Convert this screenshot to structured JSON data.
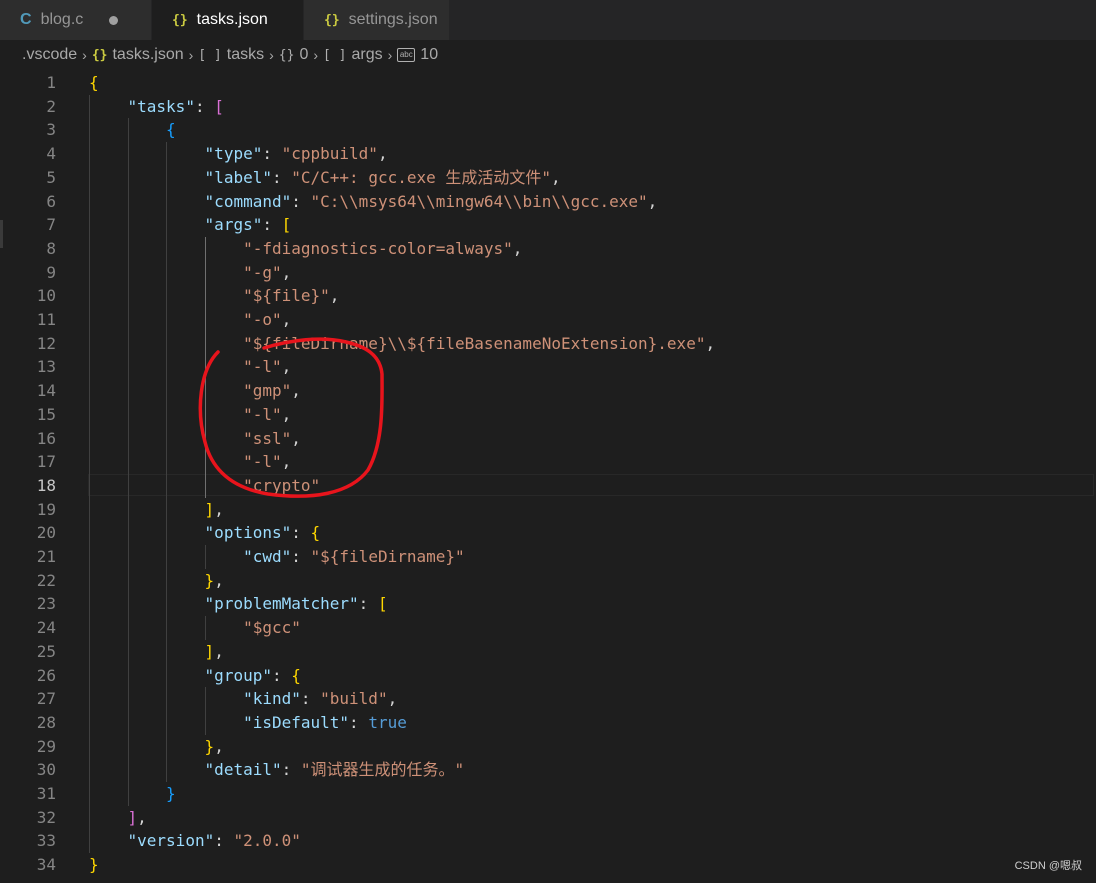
{
  "tabs": [
    {
      "label": "blog.c",
      "icon": "c-file-icon",
      "glyph": "C",
      "active": false,
      "dirty": true
    },
    {
      "label": "tasks.json",
      "icon": "json-file-icon",
      "glyph": "{}",
      "active": true,
      "dirty": true
    },
    {
      "label": "settings.json",
      "icon": "json-file-icon",
      "glyph": "{}",
      "active": false,
      "dirty": false
    }
  ],
  "breadcrumb": [
    {
      "label": ".vscode",
      "icon": ""
    },
    {
      "label": "tasks.json",
      "icon": "json-file-icon"
    },
    {
      "label": "tasks",
      "icon": "array-icon"
    },
    {
      "label": "0",
      "icon": "object-icon"
    },
    {
      "label": "args",
      "icon": "array-icon"
    },
    {
      "label": "10",
      "icon": "string-icon"
    }
  ],
  "current_line": 18,
  "lines": [
    {
      "n": "1",
      "indent": 0,
      "tokens": [
        [
          "{",
          "b1"
        ]
      ]
    },
    {
      "n": "2",
      "indent": 1,
      "tokens": [
        [
          "\"tasks\"",
          "k"
        ],
        [
          ": ",
          "p"
        ],
        [
          "[",
          "b2"
        ]
      ]
    },
    {
      "n": "3",
      "indent": 2,
      "tokens": [
        [
          "{",
          "b3"
        ]
      ]
    },
    {
      "n": "4",
      "indent": 3,
      "tokens": [
        [
          "\"type\"",
          "k"
        ],
        [
          ": ",
          "p"
        ],
        [
          "\"cppbuild\"",
          "s"
        ],
        [
          ",",
          "p"
        ]
      ]
    },
    {
      "n": "5",
      "indent": 3,
      "tokens": [
        [
          "\"label\"",
          "k"
        ],
        [
          ": ",
          "p"
        ],
        [
          "\"C/C++: gcc.exe 生成活动文件\"",
          "s"
        ],
        [
          ",",
          "p"
        ]
      ]
    },
    {
      "n": "6",
      "indent": 3,
      "tokens": [
        [
          "\"command\"",
          "k"
        ],
        [
          ": ",
          "p"
        ],
        [
          "\"C:\\\\msys64\\\\mingw64\\\\bin\\\\gcc.exe\"",
          "s"
        ],
        [
          ",",
          "p"
        ]
      ]
    },
    {
      "n": "7",
      "indent": 3,
      "tokens": [
        [
          "\"args\"",
          "k"
        ],
        [
          ": ",
          "p"
        ],
        [
          "[",
          "b1"
        ]
      ]
    },
    {
      "n": "8",
      "indent": 4,
      "tokens": [
        [
          "\"-fdiagnostics-color=always\"",
          "s"
        ],
        [
          ",",
          "p"
        ]
      ]
    },
    {
      "n": "9",
      "indent": 4,
      "tokens": [
        [
          "\"-g\"",
          "s"
        ],
        [
          ",",
          "p"
        ]
      ]
    },
    {
      "n": "10",
      "indent": 4,
      "tokens": [
        [
          "\"${file}\"",
          "s"
        ],
        [
          ",",
          "p"
        ]
      ]
    },
    {
      "n": "11",
      "indent": 4,
      "tokens": [
        [
          "\"-o\"",
          "s"
        ],
        [
          ",",
          "p"
        ]
      ]
    },
    {
      "n": "12",
      "indent": 4,
      "tokens": [
        [
          "\"${fileDirname}\\\\${fileBasenameNoExtension}.exe\"",
          "s"
        ],
        [
          ",",
          "p"
        ]
      ]
    },
    {
      "n": "13",
      "indent": 4,
      "tokens": [
        [
          "\"-l\"",
          "s"
        ],
        [
          ",",
          "p"
        ]
      ]
    },
    {
      "n": "14",
      "indent": 4,
      "tokens": [
        [
          "\"gmp\"",
          "s"
        ],
        [
          ",",
          "p"
        ]
      ]
    },
    {
      "n": "15",
      "indent": 4,
      "tokens": [
        [
          "\"-l\"",
          "s"
        ],
        [
          ",",
          "p"
        ]
      ]
    },
    {
      "n": "16",
      "indent": 4,
      "tokens": [
        [
          "\"ssl\"",
          "s"
        ],
        [
          ",",
          "p"
        ]
      ]
    },
    {
      "n": "17",
      "indent": 4,
      "tokens": [
        [
          "\"-l\"",
          "s"
        ],
        [
          ",",
          "p"
        ]
      ]
    },
    {
      "n": "18",
      "indent": 4,
      "tokens": [
        [
          "\"crypto\"",
          "s"
        ]
      ]
    },
    {
      "n": "19",
      "indent": 3,
      "tokens": [
        [
          "]",
          "b1"
        ],
        [
          ",",
          "p"
        ]
      ]
    },
    {
      "n": "20",
      "indent": 3,
      "tokens": [
        [
          "\"options\"",
          "k"
        ],
        [
          ": ",
          "p"
        ],
        [
          "{",
          "b1"
        ]
      ]
    },
    {
      "n": "21",
      "indent": 4,
      "tokens": [
        [
          "\"cwd\"",
          "k"
        ],
        [
          ": ",
          "p"
        ],
        [
          "\"${fileDirname}\"",
          "s"
        ]
      ]
    },
    {
      "n": "22",
      "indent": 3,
      "tokens": [
        [
          "}",
          "b1"
        ],
        [
          ",",
          "p"
        ]
      ]
    },
    {
      "n": "23",
      "indent": 3,
      "tokens": [
        [
          "\"problemMatcher\"",
          "k"
        ],
        [
          ": ",
          "p"
        ],
        [
          "[",
          "b1"
        ]
      ]
    },
    {
      "n": "24",
      "indent": 4,
      "tokens": [
        [
          "\"$gcc\"",
          "s"
        ]
      ]
    },
    {
      "n": "25",
      "indent": 3,
      "tokens": [
        [
          "]",
          "b1"
        ],
        [
          ",",
          "p"
        ]
      ]
    },
    {
      "n": "26",
      "indent": 3,
      "tokens": [
        [
          "\"group\"",
          "k"
        ],
        [
          ": ",
          "p"
        ],
        [
          "{",
          "b1"
        ]
      ]
    },
    {
      "n": "27",
      "indent": 4,
      "tokens": [
        [
          "\"kind\"",
          "k"
        ],
        [
          ": ",
          "p"
        ],
        [
          "\"build\"",
          "s"
        ],
        [
          ",",
          "p"
        ]
      ]
    },
    {
      "n": "28",
      "indent": 4,
      "tokens": [
        [
          "\"isDefault\"",
          "k"
        ],
        [
          ": ",
          "p"
        ],
        [
          "true",
          "kw"
        ]
      ]
    },
    {
      "n": "29",
      "indent": 3,
      "tokens": [
        [
          "}",
          "b1"
        ],
        [
          ",",
          "p"
        ]
      ]
    },
    {
      "n": "30",
      "indent": 3,
      "tokens": [
        [
          "\"detail\"",
          "k"
        ],
        [
          ": ",
          "p"
        ],
        [
          "\"调试器生成的任务。\"",
          "s"
        ]
      ]
    },
    {
      "n": "31",
      "indent": 2,
      "tokens": [
        [
          "}",
          "b3"
        ]
      ]
    },
    {
      "n": "32",
      "indent": 1,
      "tokens": [
        [
          "]",
          "b2"
        ],
        [
          ",",
          "p"
        ]
      ]
    },
    {
      "n": "33",
      "indent": 1,
      "tokens": [
        [
          "\"version\"",
          "k"
        ],
        [
          ": ",
          "p"
        ],
        [
          "\"2.0.0\"",
          "s"
        ]
      ]
    },
    {
      "n": "34",
      "indent": 0,
      "tokens": [
        [
          "}",
          "b1"
        ]
      ]
    }
  ],
  "annotation": {
    "shape": "hand-drawn-circle",
    "color": "#e8141c",
    "encloses_lines": [
      "13",
      "18"
    ]
  },
  "watermark": "CSDN @嗯叔"
}
